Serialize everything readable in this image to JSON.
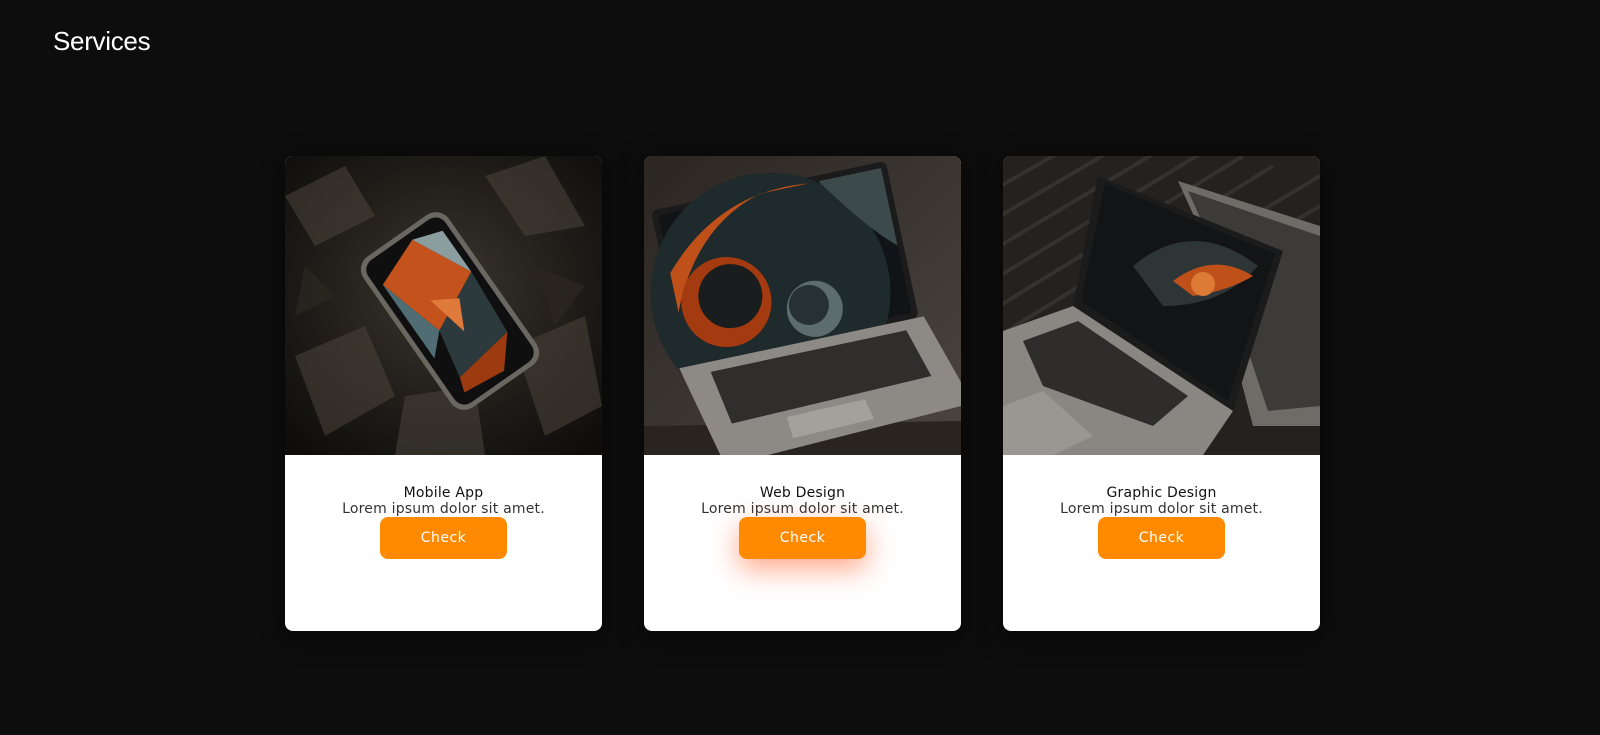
{
  "page": {
    "title": "Services"
  },
  "cards": [
    {
      "title": "Mobile App",
      "description": "Lorem ipsum dolor sit amet.",
      "button_label": "Check",
      "image": "phone-on-rock-photo"
    },
    {
      "title": "Web Design",
      "description": "Lorem ipsum dolor sit amet.",
      "button_label": "Check",
      "image": "open-laptop-photo"
    },
    {
      "title": "Graphic Design",
      "description": "Lorem ipsum dolor sit amet.",
      "button_label": "Check",
      "image": "two-laptops-photo"
    }
  ],
  "colors": {
    "background": "#0d0d0d",
    "card": "#ffffff",
    "accent": "#ff8a00"
  }
}
